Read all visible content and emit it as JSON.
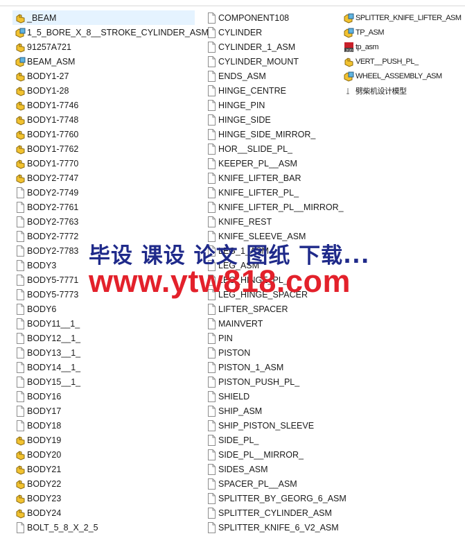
{
  "columns": [
    [
      {
        "name": "_BEAM",
        "icon": "part",
        "selected": true
      },
      {
        "name": "1_5_BORE_X_8__STROKE_CYLINDER_ASM",
        "icon": "assembly"
      },
      {
        "name": "91257A721",
        "icon": "part"
      },
      {
        "name": "BEAM_ASM",
        "icon": "assembly"
      },
      {
        "name": "BODY1-27",
        "icon": "part"
      },
      {
        "name": "BODY1-28",
        "icon": "part"
      },
      {
        "name": "BODY1-7746",
        "icon": "part"
      },
      {
        "name": "BODY1-7748",
        "icon": "part"
      },
      {
        "name": "BODY1-7760",
        "icon": "part"
      },
      {
        "name": "BODY1-7762",
        "icon": "part"
      },
      {
        "name": "BODY1-7770",
        "icon": "part"
      },
      {
        "name": "BODY2-7747",
        "icon": "part"
      },
      {
        "name": "BODY2-7749",
        "icon": "file"
      },
      {
        "name": "BODY2-7761",
        "icon": "file"
      },
      {
        "name": "BODY2-7763",
        "icon": "file"
      },
      {
        "name": "BODY2-7772",
        "icon": "file"
      },
      {
        "name": "BODY2-7783",
        "icon": "file"
      },
      {
        "name": "BODY3",
        "icon": "file"
      },
      {
        "name": "BODY5-7771",
        "icon": "file"
      },
      {
        "name": "BODY5-7773",
        "icon": "file"
      },
      {
        "name": "BODY6",
        "icon": "file"
      },
      {
        "name": "BODY11__1_",
        "icon": "file"
      },
      {
        "name": "BODY12__1_",
        "icon": "file"
      },
      {
        "name": "BODY13__1_",
        "icon": "file"
      },
      {
        "name": "BODY14__1_",
        "icon": "file"
      },
      {
        "name": "BODY15__1_",
        "icon": "file"
      },
      {
        "name": "BODY16",
        "icon": "file"
      },
      {
        "name": "BODY17",
        "icon": "file"
      },
      {
        "name": "BODY18",
        "icon": "file"
      },
      {
        "name": "BODY19",
        "icon": "part"
      },
      {
        "name": "BODY20",
        "icon": "part"
      },
      {
        "name": "BODY21",
        "icon": "part"
      },
      {
        "name": "BODY22",
        "icon": "part"
      },
      {
        "name": "BODY23",
        "icon": "part"
      },
      {
        "name": "BODY24",
        "icon": "part"
      },
      {
        "name": "BOLT_5_8_X_2_5",
        "icon": "file"
      }
    ],
    [
      {
        "name": "COMPONENT108",
        "icon": "file"
      },
      {
        "name": "CYLINDER",
        "icon": "file"
      },
      {
        "name": "CYLINDER_1_ASM",
        "icon": "file"
      },
      {
        "name": "CYLINDER_MOUNT",
        "icon": "file"
      },
      {
        "name": "ENDS_ASM",
        "icon": "file"
      },
      {
        "name": "HINGE_CENTRE",
        "icon": "file"
      },
      {
        "name": "HINGE_PIN",
        "icon": "file"
      },
      {
        "name": "HINGE_SIDE",
        "icon": "file"
      },
      {
        "name": "HINGE_SIDE_MIRROR_",
        "icon": "file"
      },
      {
        "name": "HOR__SLIDE_PL_",
        "icon": "file"
      },
      {
        "name": "KEEPER_PL__ASM",
        "icon": "file"
      },
      {
        "name": "KNIFE_LIFTER_BAR",
        "icon": "file"
      },
      {
        "name": "KNIFE_LIFTER_PL_",
        "icon": "file"
      },
      {
        "name": "KNIFE_LIFTER_PL__MIRROR_",
        "icon": "file"
      },
      {
        "name": "KNIFE_REST",
        "icon": "file"
      },
      {
        "name": "KNIFE_SLEEVE_ASM",
        "icon": "file"
      },
      {
        "name": "LEG_1_ASM",
        "icon": "file"
      },
      {
        "name": "LEG_ASM",
        "icon": "file"
      },
      {
        "name": "LEG_HINGE_PL_",
        "icon": "file"
      },
      {
        "name": "LEG_HINGE_SPACER",
        "icon": "file"
      },
      {
        "name": "LIFTER_SPACER",
        "icon": "file"
      },
      {
        "name": "MAINVERT",
        "icon": "file"
      },
      {
        "name": "PIN",
        "icon": "file"
      },
      {
        "name": "PISTON",
        "icon": "file"
      },
      {
        "name": "PISTON_1_ASM",
        "icon": "file"
      },
      {
        "name": "PISTON_PUSH_PL_",
        "icon": "file"
      },
      {
        "name": "SHIELD",
        "icon": "file"
      },
      {
        "name": "SHIP_ASM",
        "icon": "file"
      },
      {
        "name": "SHIP_PISTON_SLEEVE",
        "icon": "file"
      },
      {
        "name": "SIDE_PL_",
        "icon": "file"
      },
      {
        "name": "SIDE_PL__MIRROR_",
        "icon": "file"
      },
      {
        "name": "SIDES_ASM",
        "icon": "file"
      },
      {
        "name": "SPACER_PL__ASM",
        "icon": "file"
      },
      {
        "name": "SPLITTER_BY_GEORG_6_ASM",
        "icon": "file"
      },
      {
        "name": "SPLITTER_CYLINDER_ASM",
        "icon": "file"
      },
      {
        "name": "SPLITTER_KNIFE_6_V2_ASM",
        "icon": "file"
      }
    ],
    [
      {
        "name": "SPLITTER_KNIFE_LIFTER_ASM",
        "icon": "assembly"
      },
      {
        "name": "TP_ASM",
        "icon": "assembly"
      },
      {
        "name": "tp_asm",
        "icon": "solidworks-2020"
      },
      {
        "name": "VERT__PUSH_PL_",
        "icon": "part"
      },
      {
        "name": "WHEEL_ASSEMBLY_ASM",
        "icon": "assembly"
      },
      {
        "name": "劈柴机设计模型",
        "icon": "shortcut"
      }
    ]
  ],
  "watermark": {
    "line1": "毕设 课设 论文 图纸 下载...",
    "line2": "www.ytw818.com"
  },
  "colors": {
    "selection": "#e5f3ff",
    "part": "#f2c230",
    "assembly_blue": "#5fb3e0",
    "watermark_blue": "#1f2a8a",
    "watermark_red": "#e3212b"
  }
}
